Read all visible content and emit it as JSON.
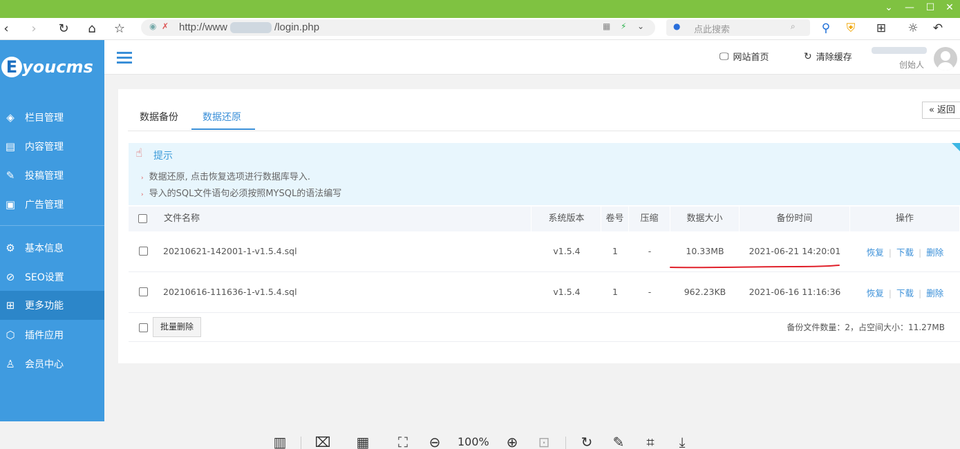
{
  "browser": {
    "url_prefix": "http://www",
    "url_suffix": "/login.php",
    "search_placeholder": "点此搜索"
  },
  "sidebar": {
    "logo_letter": "E",
    "logo_text": "youcms",
    "items": [
      {
        "label": "栏目管理",
        "icon": "layers-icon"
      },
      {
        "label": "内容管理",
        "icon": "document-icon"
      },
      {
        "label": "投稿管理",
        "icon": "edit-icon"
      },
      {
        "label": "广告管理",
        "icon": "ad-icon"
      },
      {
        "label": "基本信息",
        "icon": "gear-icon"
      },
      {
        "label": "SEO设置",
        "icon": "seo-icon"
      },
      {
        "label": "更多功能",
        "icon": "grid-icon",
        "active": true
      },
      {
        "label": "插件应用",
        "icon": "cube-icon"
      },
      {
        "label": "会员中心",
        "icon": "user-icon"
      }
    ]
  },
  "header": {
    "site_home": "网站首页",
    "clear_cache": "清除缓存",
    "user_role": "创始人"
  },
  "tabs": {
    "backup": "数据备份",
    "restore": "数据还原"
  },
  "back_button": "« 返回",
  "tips": {
    "title": "提示",
    "lines": [
      "数据还原, 点击恢复选项进行数据库导入.",
      "导入的SQL文件语句必须按照MYSQL的语法编写"
    ]
  },
  "table": {
    "headers": {
      "filename": "文件名称",
      "version": "系统版本",
      "volume": "卷号",
      "compress": "压缩",
      "size": "数据大小",
      "time": "备份时间",
      "ops": "操作"
    },
    "rows": [
      {
        "filename": "20210621-142001-1-v1.5.4.sql",
        "version": "v1.5.4",
        "volume": "1",
        "compress": "-",
        "size": "10.33MB",
        "time": "2021-06-21 14:20:01"
      },
      {
        "filename": "20210616-111636-1-v1.5.4.sql",
        "version": "v1.5.4",
        "volume": "1",
        "compress": "-",
        "size": "962.23KB",
        "time": "2021-06-16 11:16:36"
      }
    ],
    "op_labels": {
      "restore": "恢复",
      "download": "下载",
      "delete": "删除"
    }
  },
  "footer": {
    "batch_delete": "批量删除",
    "summary": "备份文件数量：2，占空间大小：11.27MB"
  },
  "viewer": {
    "zoom": "100%"
  },
  "colors": {
    "sidebar_bg": "#3f9be0",
    "sidebar_active": "#2c86c9",
    "accent": "#3a8fd8",
    "window_bar": "#7fc241",
    "annotation_red": "#e0202a"
  }
}
